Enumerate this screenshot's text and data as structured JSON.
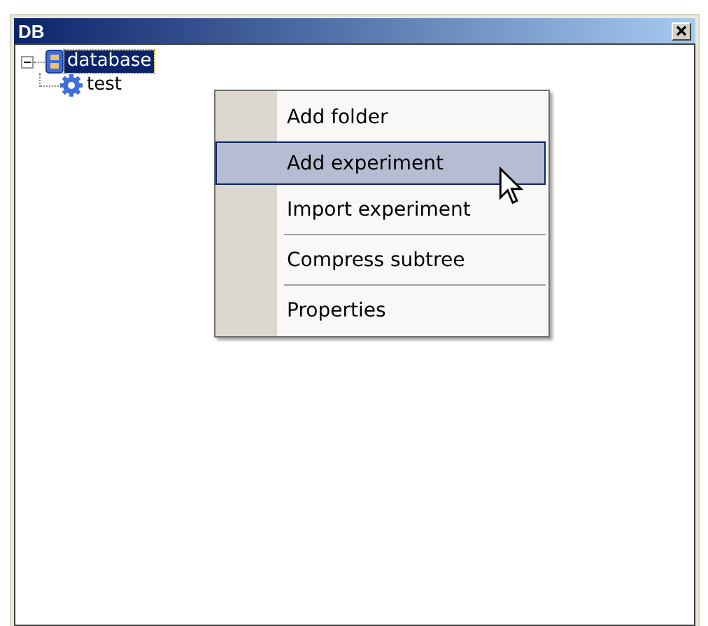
{
  "window": {
    "title": "DB"
  },
  "tree": [
    {
      "label": "database",
      "kind": "database",
      "expanded": true,
      "selected": true,
      "children": [
        {
          "label": "test",
          "kind": "experiment",
          "selected": false
        }
      ]
    }
  ],
  "context_menu": {
    "items": [
      {
        "kind": "item",
        "label": "Add folder",
        "selected": false
      },
      {
        "kind": "item",
        "label": "Add experiment",
        "selected": true
      },
      {
        "kind": "item",
        "label": "Import experiment",
        "selected": false
      },
      {
        "kind": "separator"
      },
      {
        "kind": "item",
        "label": "Compress subtree",
        "selected": false
      },
      {
        "kind": "separator"
      },
      {
        "kind": "item",
        "label": "Properties",
        "selected": false
      }
    ]
  }
}
